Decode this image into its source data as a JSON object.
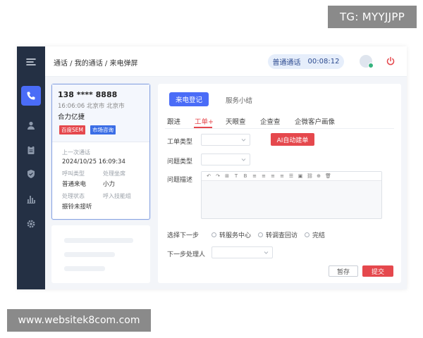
{
  "watermarks": {
    "telegram": "TG: MYYJJPP",
    "site": "www.websitek8com.com"
  },
  "colors": {
    "sidebar_bg": "#243044",
    "accent_blue": "#4a6cf7",
    "accent_red": "#e5484d",
    "status_online": "#36b37e"
  },
  "sidebar": {
    "items": [
      {
        "icon": "menu-icon",
        "active": false
      },
      {
        "icon": "phone-icon",
        "active": true
      },
      {
        "icon": "user-icon",
        "active": false
      },
      {
        "icon": "clipboard-icon",
        "active": false
      },
      {
        "icon": "shield-check-icon",
        "active": false
      },
      {
        "icon": "bar-chart-icon",
        "active": false
      },
      {
        "icon": "gear-icon",
        "active": false
      }
    ]
  },
  "header": {
    "breadcrumb": "通话 / 我的通话 / 来电弹屏",
    "call_type": "普通通话",
    "call_timer": "00:08:12"
  },
  "caller": {
    "phone": "138 **** 8888",
    "meta": "16:06:06  北京市 北京市",
    "company": "合力亿捷",
    "tags": [
      "百度SEM",
      "市场咨询"
    ],
    "last_call_label": "上一次通话",
    "last_call_time": "2024/10/25  16:09:34",
    "call_type_label": "呼叫类型",
    "call_type_value": "普通来电",
    "handler_label": "处理坐席",
    "handler_value": "小力",
    "status_label": "处理状态",
    "status_value": "振铃未接听",
    "skill_group_label": "呼入技能组",
    "skill_group_value": ""
  },
  "panel": {
    "tabs": [
      "来电登记",
      "服务小结"
    ],
    "subtabs": [
      "跟进",
      "工单+",
      "天眼查",
      "企查查",
      "企微客户画像"
    ],
    "form": {
      "ticket_type_label": "工单类型",
      "issue_type_label": "问题类型",
      "ai_button": "AI自动建单",
      "issue_desc_label": "问题描述",
      "next_step_label": "选择下一步",
      "next_step_options": [
        "转服务中心",
        "转调查回访",
        "完结"
      ],
      "next_handler_label": "下一步处理人"
    },
    "editor_tools": [
      "↶",
      "↷",
      "⊞",
      "T",
      "B",
      "≡",
      "≡",
      "≡",
      "≡",
      "☰",
      "▣",
      "⛓",
      "⊕",
      "🗑"
    ],
    "save_label": "暂存",
    "submit_label": "提交"
  }
}
